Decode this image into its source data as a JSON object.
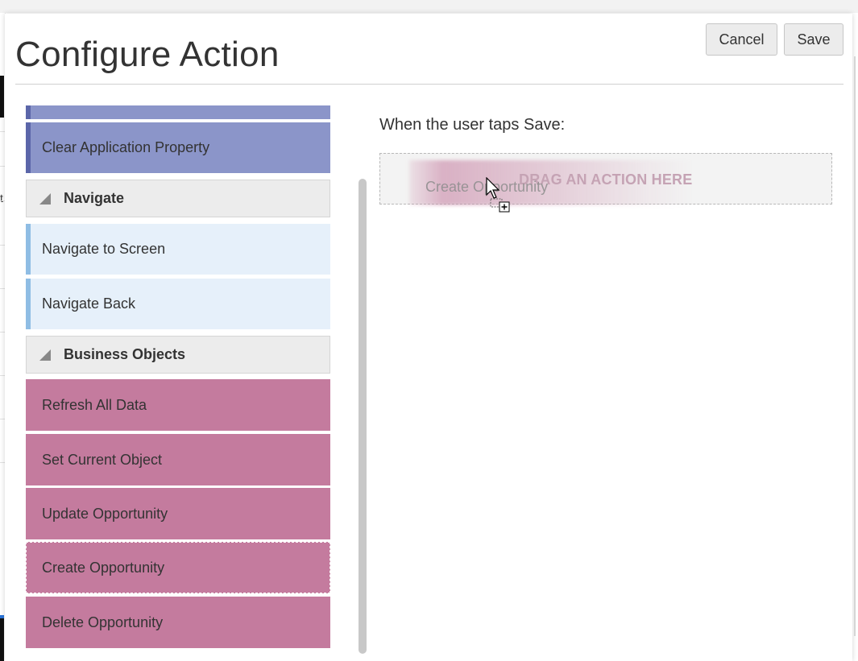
{
  "dialog": {
    "title": "Configure Action",
    "buttons": {
      "cancel": "Cancel",
      "save": "Save"
    }
  },
  "palette": {
    "top_item": "Clear Application Property",
    "groups": [
      {
        "label": "Navigate",
        "items": [
          "Navigate to Screen",
          "Navigate Back"
        ]
      },
      {
        "label": "Business Objects",
        "items": [
          "Refresh All Data",
          "Set Current Object",
          "Update Opportunity",
          "Create Opportunity",
          "Delete Opportunity"
        ]
      }
    ],
    "colors": {
      "app_property": "#8b95c9",
      "navigate": "#e6f0fa",
      "business_objects": "#c47b9e"
    }
  },
  "canvas": {
    "prompt": "When the user taps Save:",
    "drop_hint": "DRAG AN ACTION HERE",
    "dragged_item": "Create Opportunity"
  },
  "background": {
    "partial_text": "t"
  }
}
